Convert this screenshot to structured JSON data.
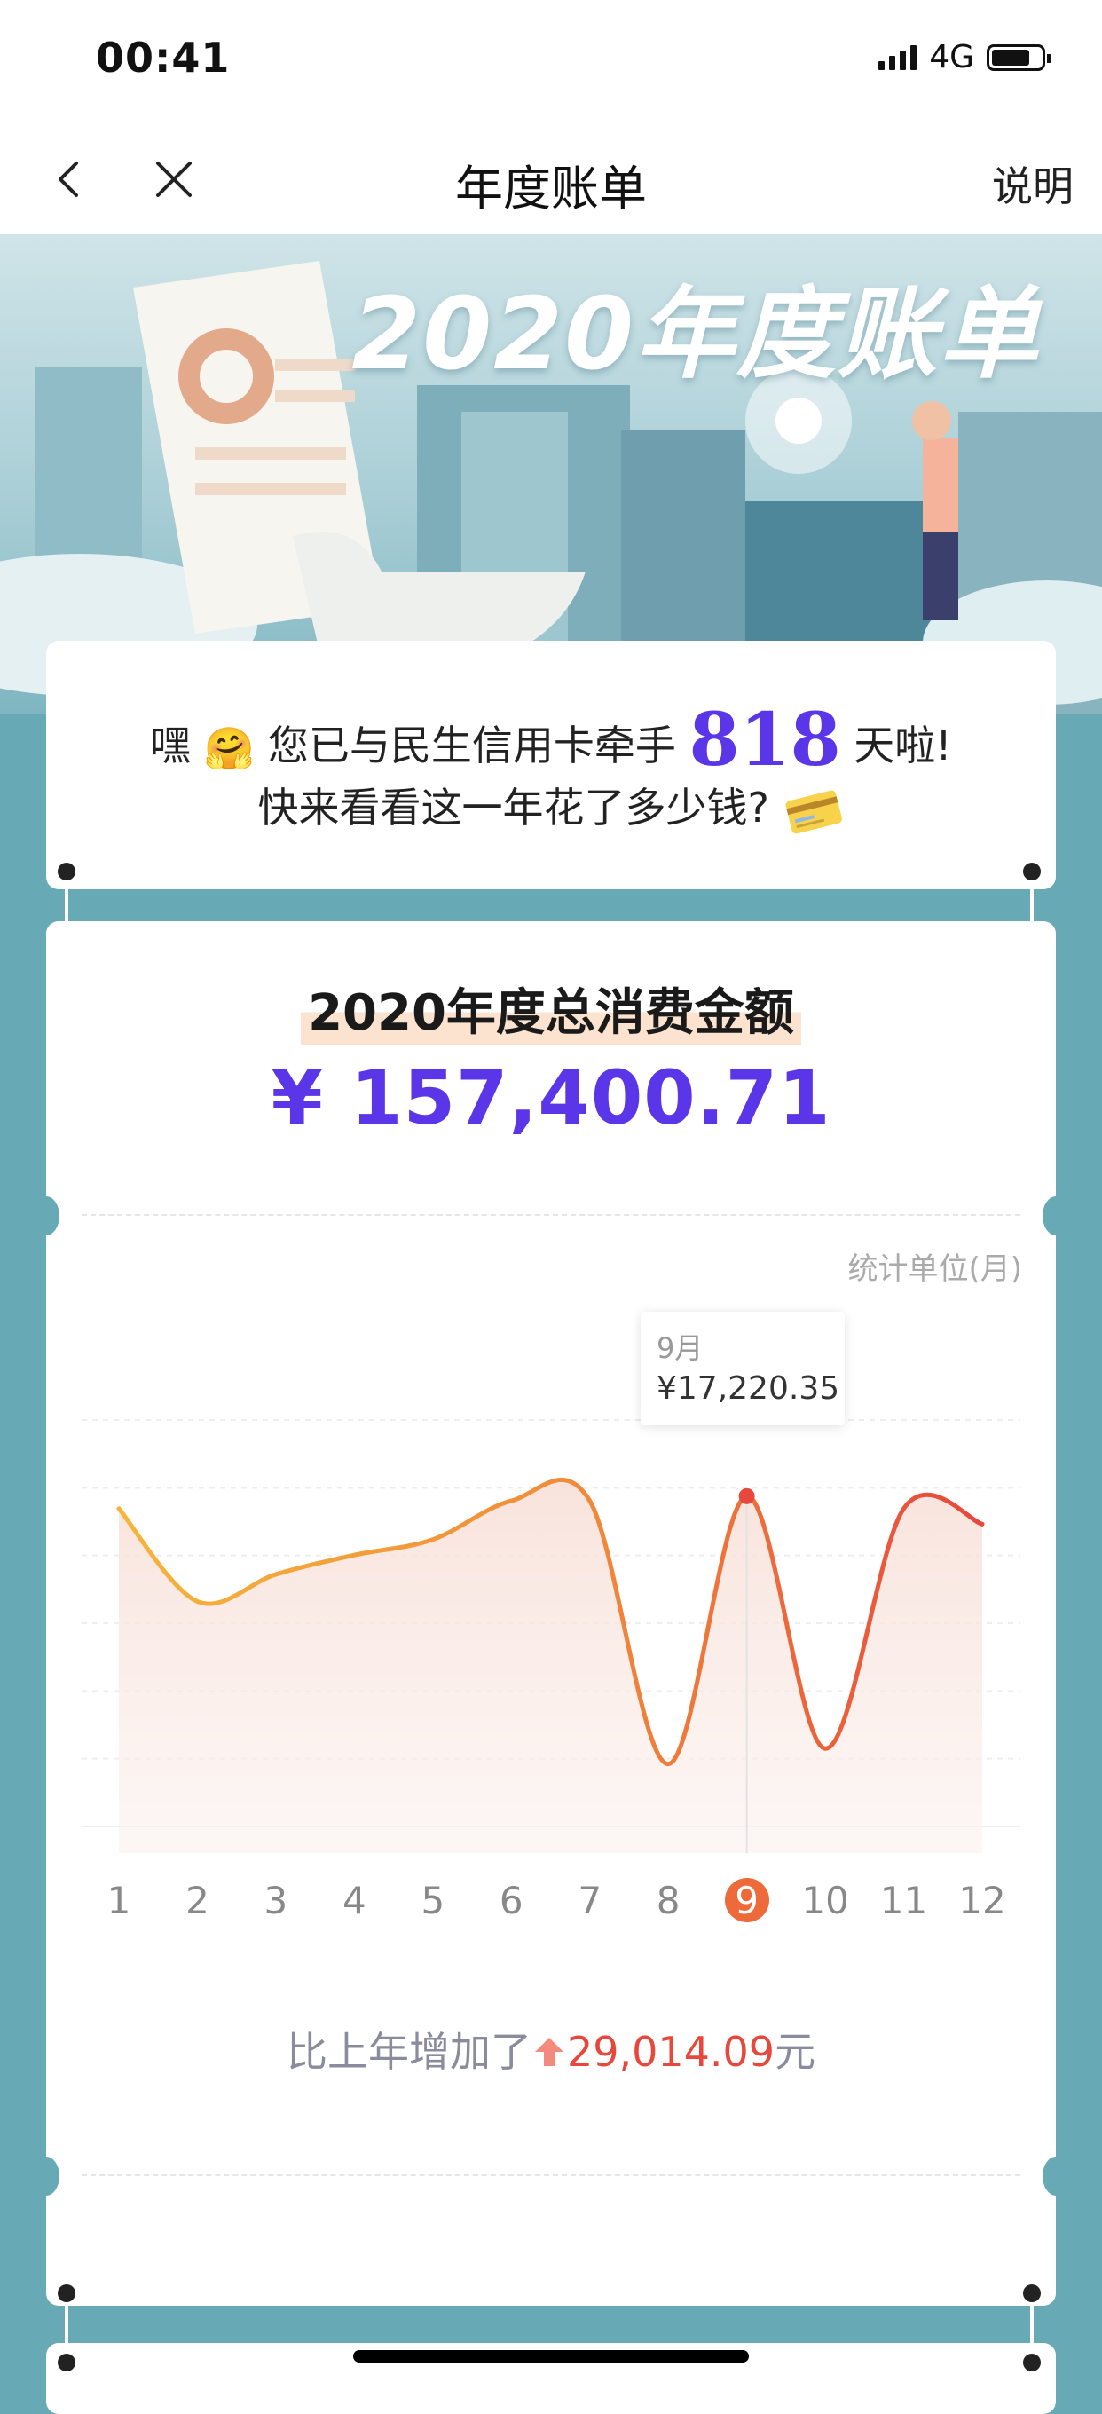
{
  "status_bar": {
    "time": "00:41",
    "network": "4G"
  },
  "nav": {
    "title": "年度账单",
    "help_label": "说明"
  },
  "banner": {
    "title": "2020年度账单"
  },
  "greeting": {
    "line1_prefix": "嘿",
    "line1_emoji": "🤗",
    "line1_mid": "您已与民生信用卡牵手",
    "days": "818",
    "line1_suffix": "天啦!",
    "line2": "快来看看这一年花了多少钱?"
  },
  "summary": {
    "title": "2020年度总消费金额",
    "amount": "¥ 157,400.71",
    "unit_label": "统计单位(月)",
    "tooltip_month": "9月",
    "tooltip_value": "¥17,220.35",
    "selected_month": "9",
    "increase_prefix": "比上年增加了",
    "increase_value": "29,014.09",
    "increase_suffix": "元"
  },
  "chart_data": {
    "type": "area",
    "x": [
      "1",
      "2",
      "3",
      "4",
      "5",
      "6",
      "7",
      "8",
      "9",
      "10",
      "11",
      "12"
    ],
    "series": [
      {
        "values": [
          16900,
          14500,
          15200,
          15700,
          16100,
          17100,
          17100,
          10300,
          17220.35,
          10700,
          16900,
          16500
        ]
      }
    ],
    "xlabel": "",
    "ylabel": "统计单位(月)",
    "highlight": {
      "x": "9",
      "value": 17220.35
    },
    "grid": true,
    "colors": {
      "line_start": "#f5b53c",
      "line_end": "#e8473c",
      "fill": "#f8e3dd"
    }
  },
  "colors": {
    "accent": "#5b35e8",
    "background": "#67aab6",
    "increase": "#e8473c"
  }
}
